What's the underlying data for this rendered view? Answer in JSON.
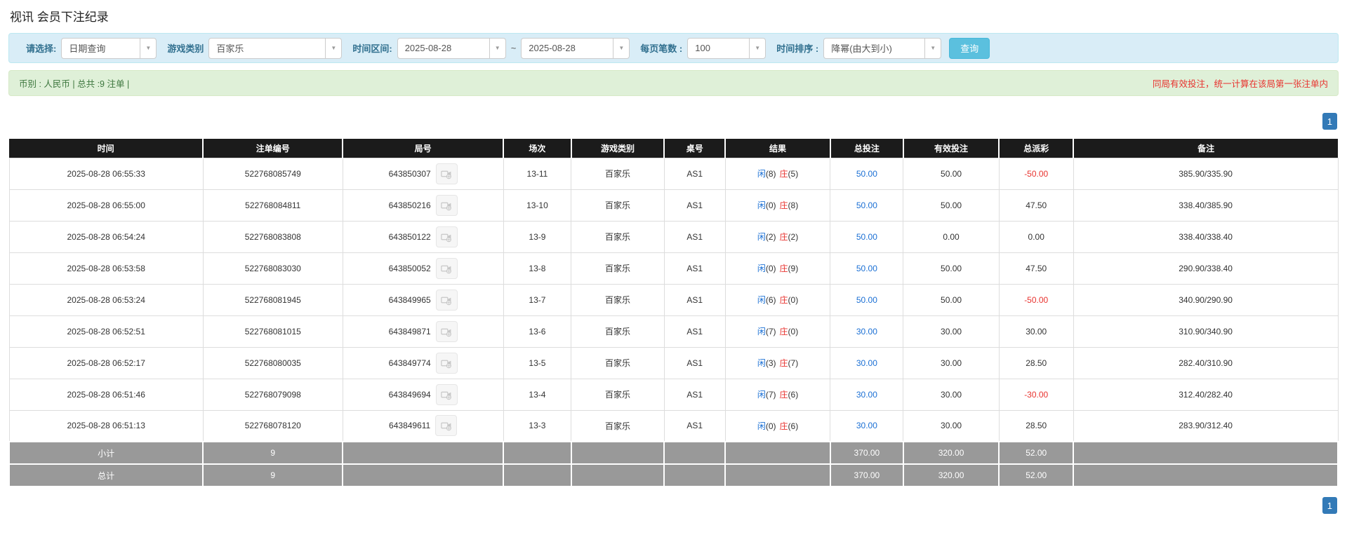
{
  "page": {
    "title": "视讯 会员下注纪录"
  },
  "filters": {
    "select_label": "请选择:",
    "select_value": "日期查询",
    "game_type_label": "游戏类别",
    "game_type_value": "百家乐",
    "date_range_label": "时间区间:",
    "date_from": "2025-08-28",
    "date_separator": "~",
    "date_to": "2025-08-28",
    "page_size_label": "每页笔数 :",
    "page_size_value": "100",
    "sort_label": "时间排序 :",
    "sort_value": "降幂(由大到小)",
    "search_button": "查询"
  },
  "summary_bar": {
    "left_text": "币别 : 人民币 | 总共 :9 注单 |",
    "right_text": "同局有效投注，统一计算在该局第一张注单内"
  },
  "pagination": {
    "page": "1"
  },
  "icons": {
    "dropdown": "chevron-down-icon",
    "round_video": "video-replay-icon"
  },
  "colors": {
    "filter_bar_bg": "#d9edf7",
    "summary_bar_bg": "#dff0d8",
    "summary_text_green": "#3c763d",
    "notice_red": "#e8322e",
    "link_blue": "#1a6fd4",
    "header_bg": "#1b1b1b",
    "totals_row_bg": "#999999",
    "pagination_active": "#337ab7",
    "search_button": "#5bc0de"
  },
  "table": {
    "headers": [
      "时间",
      "注单编号",
      "局号",
      "场次",
      "游戏类别",
      "桌号",
      "结果",
      "总投注",
      "有效投注",
      "总派彩",
      "备注"
    ],
    "rows": [
      {
        "time": "2025-08-28 06:55:33",
        "bet_id": "522768085749",
        "round_id": "643850307",
        "session": "13-11",
        "game": "百家乐",
        "table_no": "AS1",
        "player": "闲",
        "player_n": "(8)",
        "banker": "庄",
        "banker_n": "(5)",
        "total_bet": "50.00",
        "valid_bet": "50.00",
        "payout": "-50.00",
        "note": "385.90/335.90"
      },
      {
        "time": "2025-08-28 06:55:00",
        "bet_id": "522768084811",
        "round_id": "643850216",
        "session": "13-10",
        "game": "百家乐",
        "table_no": "AS1",
        "player": "闲",
        "player_n": "(0)",
        "banker": "庄",
        "banker_n": "(8)",
        "total_bet": "50.00",
        "valid_bet": "50.00",
        "payout": "47.50",
        "note": "338.40/385.90"
      },
      {
        "time": "2025-08-28 06:54:24",
        "bet_id": "522768083808",
        "round_id": "643850122",
        "session": "13-9",
        "game": "百家乐",
        "table_no": "AS1",
        "player": "闲",
        "player_n": "(2)",
        "banker": "庄",
        "banker_n": "(2)",
        "total_bet": "50.00",
        "valid_bet": "0.00",
        "payout": "0.00",
        "note": "338.40/338.40"
      },
      {
        "time": "2025-08-28 06:53:58",
        "bet_id": "522768083030",
        "round_id": "643850052",
        "session": "13-8",
        "game": "百家乐",
        "table_no": "AS1",
        "player": "闲",
        "player_n": "(0)",
        "banker": "庄",
        "banker_n": "(9)",
        "total_bet": "50.00",
        "valid_bet": "50.00",
        "payout": "47.50",
        "note": "290.90/338.40"
      },
      {
        "time": "2025-08-28 06:53:24",
        "bet_id": "522768081945",
        "round_id": "643849965",
        "session": "13-7",
        "game": "百家乐",
        "table_no": "AS1",
        "player": "闲",
        "player_n": "(6)",
        "banker": "庄",
        "banker_n": "(0)",
        "total_bet": "50.00",
        "valid_bet": "50.00",
        "payout": "-50.00",
        "note": "340.90/290.90"
      },
      {
        "time": "2025-08-28 06:52:51",
        "bet_id": "522768081015",
        "round_id": "643849871",
        "session": "13-6",
        "game": "百家乐",
        "table_no": "AS1",
        "player": "闲",
        "player_n": "(7)",
        "banker": "庄",
        "banker_n": "(0)",
        "total_bet": "30.00",
        "valid_bet": "30.00",
        "payout": "30.00",
        "note": "310.90/340.90"
      },
      {
        "time": "2025-08-28 06:52:17",
        "bet_id": "522768080035",
        "round_id": "643849774",
        "session": "13-5",
        "game": "百家乐",
        "table_no": "AS1",
        "player": "闲",
        "player_n": "(3)",
        "banker": "庄",
        "banker_n": "(7)",
        "total_bet": "30.00",
        "valid_bet": "30.00",
        "payout": "28.50",
        "note": "282.40/310.90"
      },
      {
        "time": "2025-08-28 06:51:46",
        "bet_id": "522768079098",
        "round_id": "643849694",
        "session": "13-4",
        "game": "百家乐",
        "table_no": "AS1",
        "player": "闲",
        "player_n": "(7)",
        "banker": "庄",
        "banker_n": "(6)",
        "total_bet": "30.00",
        "valid_bet": "30.00",
        "payout": "-30.00",
        "note": "312.40/282.40"
      },
      {
        "time": "2025-08-28 06:51:13",
        "bet_id": "522768078120",
        "round_id": "643849611",
        "session": "13-3",
        "game": "百家乐",
        "table_no": "AS1",
        "player": "闲",
        "player_n": "(0)",
        "banker": "庄",
        "banker_n": "(6)",
        "total_bet": "30.00",
        "valid_bet": "30.00",
        "payout": "28.50",
        "note": "283.90/312.40"
      }
    ],
    "subtotal": {
      "label": "小计",
      "count": "9",
      "total_bet": "370.00",
      "valid_bet": "320.00",
      "payout": "52.00"
    },
    "total": {
      "label": "总计",
      "count": "9",
      "total_bet": "370.00",
      "valid_bet": "320.00",
      "payout": "52.00"
    }
  }
}
